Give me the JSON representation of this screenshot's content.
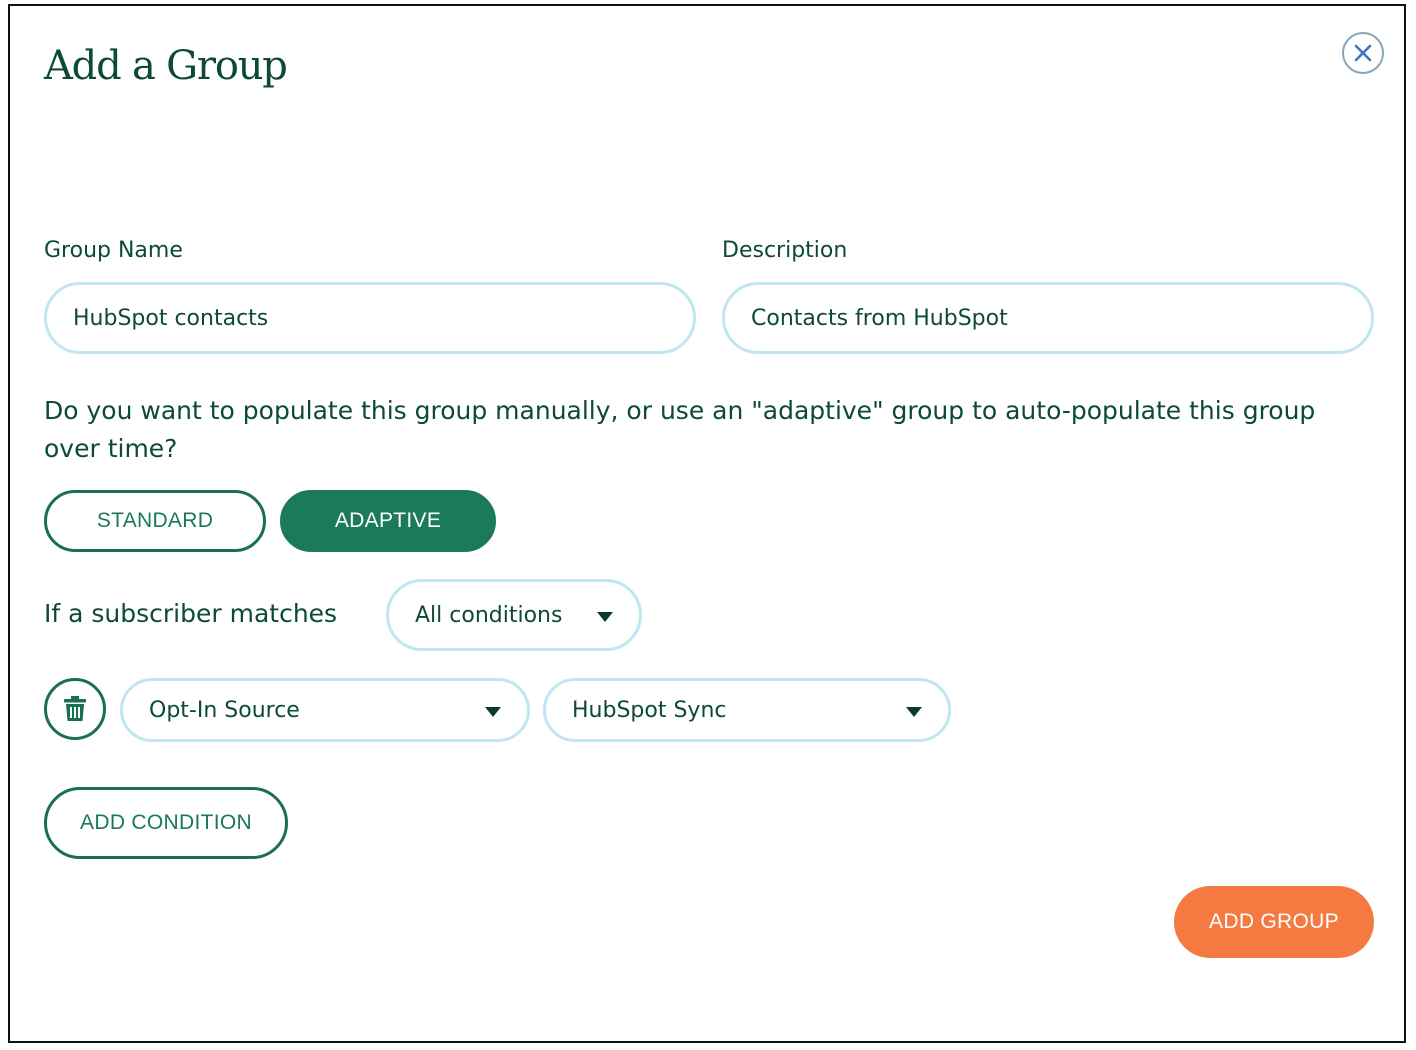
{
  "modal": {
    "title": "Add a Group"
  },
  "fields": {
    "group_name": {
      "label": "Group Name",
      "value": "HubSpot contacts"
    },
    "description": {
      "label": "Description",
      "value": "Contacts from HubSpot"
    }
  },
  "question": "Do you want to populate this group manually, or use an \"adaptive\" group to auto-populate this group over time?",
  "group_type": {
    "options": [
      "STANDARD",
      "ADAPTIVE"
    ],
    "selected": "ADAPTIVE"
  },
  "match": {
    "label": "If a subscriber matches",
    "selected": "All conditions"
  },
  "conditions": [
    {
      "field": "Opt-In Source",
      "value": "HubSpot Sync"
    }
  ],
  "buttons": {
    "add_condition": "ADD CONDITION",
    "add_group": "ADD GROUP"
  },
  "icons": {
    "close": "close-icon",
    "trash": "trash-icon",
    "caret": "caret-down-icon"
  },
  "colors": {
    "text_primary": "#0d4a36",
    "accent_green": "#1a7a5a",
    "field_border": "#c0e6f0",
    "cta_orange": "#f47a42",
    "close_blue": "#3a78c2"
  }
}
